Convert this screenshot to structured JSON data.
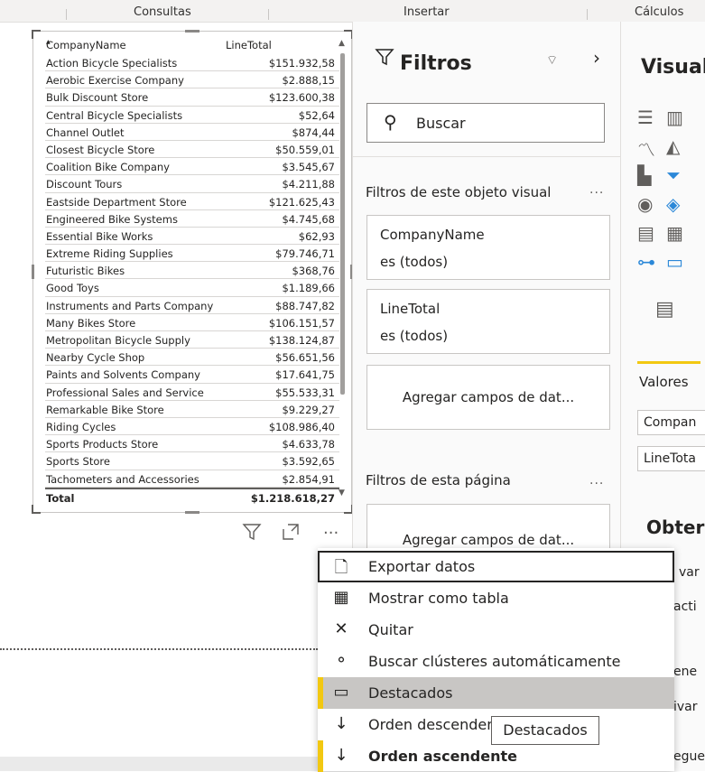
{
  "ribbon": {
    "groups": [
      "Consultas",
      "Insertar",
      "Cálculos"
    ]
  },
  "table_visual": {
    "columns": [
      "CompanyName",
      "LineTotal"
    ],
    "rows": [
      [
        "Action Bicycle Specialists",
        "$151.932,58"
      ],
      [
        "Aerobic Exercise Company",
        "$2.888,15"
      ],
      [
        "Bulk Discount Store",
        "$123.600,38"
      ],
      [
        "Central Bicycle Specialists",
        "$52,64"
      ],
      [
        "Channel Outlet",
        "$874,44"
      ],
      [
        "Closest Bicycle Store",
        "$50.559,01"
      ],
      [
        "Coalition Bike Company",
        "$3.545,67"
      ],
      [
        "Discount Tours",
        "$4.211,88"
      ],
      [
        "Eastside Department Store",
        "$121.625,43"
      ],
      [
        "Engineered Bike Systems",
        "$4.745,68"
      ],
      [
        "Essential Bike Works",
        "$62,93"
      ],
      [
        "Extreme Riding Supplies",
        "$79.746,71"
      ],
      [
        "Futuristic Bikes",
        "$368,76"
      ],
      [
        "Good Toys",
        "$1.189,66"
      ],
      [
        "Instruments and Parts Company",
        "$88.747,82"
      ],
      [
        "Many Bikes Store",
        "$106.151,57"
      ],
      [
        "Metropolitan Bicycle Supply",
        "$138.124,87"
      ],
      [
        "Nearby Cycle Shop",
        "$56.651,56"
      ],
      [
        "Paints and Solvents Company",
        "$17.641,75"
      ],
      [
        "Professional Sales and Service",
        "$55.533,31"
      ],
      [
        "Remarkable Bike Store",
        "$9.229,27"
      ],
      [
        "Riding Cycles",
        "$108.986,40"
      ],
      [
        "Sports Products Store",
        "$4.633,78"
      ],
      [
        "Sports Store",
        "$3.592,65"
      ],
      [
        "Tachometers and Accessories",
        "$2.854,91"
      ]
    ],
    "total": [
      "Total",
      "$1.218.618,27"
    ]
  },
  "filters": {
    "title": "Filtros",
    "search_placeholder": "Buscar",
    "visual_section": "Filtros de este objeto visual",
    "section_dots": "...",
    "cards": [
      {
        "field": "CompanyName",
        "state": "es (todos)"
      },
      {
        "field": "LineTotal",
        "state": "es (todos)"
      }
    ],
    "add_fields": "Agregar campos de dat...",
    "page_section": "Filtros de esta página",
    "page_add_fields": "Agregar campos de dat..."
  },
  "visualizations": {
    "title": "Visual",
    "values_label": "Valores",
    "fields": [
      "Compan",
      "LineTota"
    ],
    "obtain_label": "Obter",
    "side_texts": [
      "var",
      "acti",
      "ene",
      "ivar",
      "egue"
    ]
  },
  "context_menu": {
    "items": [
      {
        "icon": "export-icon",
        "glyph": "🗋",
        "label": "Exportar datos"
      },
      {
        "icon": "table-view-icon",
        "glyph": "▦",
        "label": "Mostrar como tabla"
      },
      {
        "icon": "close-icon",
        "glyph": "✕",
        "label": "Quitar"
      },
      {
        "icon": "cluster-icon",
        "glyph": "⚬",
        "label": "Buscar clústeres automáticamente"
      },
      {
        "icon": "spotlight-icon",
        "glyph": "▭",
        "label": "Destacados"
      },
      {
        "icon": "sort-desc-icon",
        "glyph": "↓",
        "label": "Orden descendente"
      },
      {
        "icon": "sort-asc-icon",
        "glyph": "↓",
        "label": "Orden ascendente"
      }
    ]
  },
  "tooltip": "Destacados",
  "colors": {
    "accent": "#f2c811",
    "highlight": "#c8c6c4",
    "pane_bg": "#fafafa"
  }
}
